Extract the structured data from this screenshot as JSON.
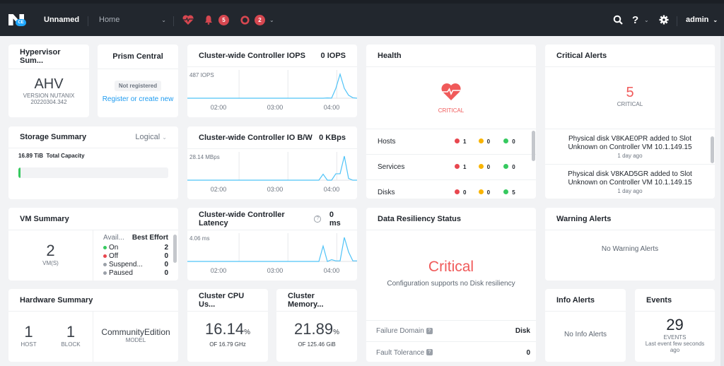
{
  "topbar": {
    "cluster_name": "Unnamed",
    "logo_badge": "CE",
    "nav_current": "Home",
    "alerts_count": "5",
    "tasks_count": "2",
    "user": "admin",
    "icons": [
      "health-heart-icon",
      "bell-icon",
      "circle-task-icon",
      "search-icon",
      "help-icon",
      "gear-icon"
    ]
  },
  "hypervisor": {
    "title": "Hypervisor Sum...",
    "name": "AHV",
    "version_label": "VERSION NUTANIX",
    "version": "20220304.342"
  },
  "prism_central": {
    "title": "Prism Central",
    "status": "Not registered",
    "link": "Register or create new"
  },
  "storage": {
    "title": "Storage Summary",
    "view": "Logical",
    "capacity_value": "16.89 TiB",
    "capacity_label": "Total Capacity",
    "used_fraction": 0.005,
    "bar_color": "#36c95f"
  },
  "vm_summary": {
    "title": "VM Summary",
    "count": "2",
    "count_label": "VM(S)",
    "col1": "Avail...",
    "col2": "Best Effort",
    "rows": [
      {
        "label": "On",
        "value": "2",
        "color": "#36c95f"
      },
      {
        "label": "Off",
        "value": "0",
        "color": "#e8474f"
      },
      {
        "label": "Suspend...",
        "value": "0",
        "color": "#9aa0a8"
      },
      {
        "label": "Paused",
        "value": "0",
        "color": "#9aa0a8"
      }
    ]
  },
  "hardware": {
    "title": "Hardware Summary",
    "hosts": "1",
    "hosts_label": "HOST",
    "blocks": "1",
    "blocks_label": "BLOCK",
    "model": "CommunityEdition",
    "model_label": "MODEL"
  },
  "iops": {
    "title": "Cluster-wide Controller IOPS",
    "current": "0 IOPS",
    "max_label": "487 IOPS"
  },
  "iobw": {
    "title": "Cluster-wide Controller IO B/W",
    "current": "0 KBps",
    "max_label": "28.14 MBps"
  },
  "latency": {
    "title": "Cluster-wide Controller Latency",
    "current": "0 ms",
    "max_label": "4.06 ms"
  },
  "cpu": {
    "title": "Cluster CPU Us...",
    "value": "16.14",
    "unit": "%",
    "of": "OF 16.79 GHz"
  },
  "memory": {
    "title": "Cluster Memory...",
    "value": "21.89",
    "unit": "%",
    "of": "OF 125.46 GiB"
  },
  "health": {
    "title": "Health",
    "status": "CRITICAL",
    "rows": [
      {
        "label": "Hosts",
        "critical": "1",
        "warning": "0",
        "good": "0"
      },
      {
        "label": "Services",
        "critical": "1",
        "warning": "0",
        "good": "0"
      },
      {
        "label": "Disks",
        "critical": "0",
        "warning": "0",
        "good": "5"
      }
    ],
    "colors": {
      "critical": "#e8474f",
      "warning": "#f9b400",
      "good": "#36c95f"
    }
  },
  "resiliency": {
    "title": "Data Resiliency Status",
    "status": "Critical",
    "message": "Configuration supports no Disk resiliency",
    "failure_domain_label": "Failure Domain",
    "failure_domain": "Disk",
    "fault_tolerance_label": "Fault Tolerance",
    "fault_tolerance": "0"
  },
  "critical_alerts": {
    "title": "Critical Alerts",
    "count": "5",
    "label": "CRITICAL",
    "items": [
      {
        "text": "Physical disk V8KAE0PR added to Slot Unknown on Controller VM 10.1.149.15",
        "time": "1 day ago"
      },
      {
        "text": "Physical disk V8KAD5GR added to Slot Unknown on Controller VM 10.1.149.15",
        "time": "1 day ago"
      }
    ]
  },
  "warning_alerts": {
    "title": "Warning Alerts",
    "empty": "No Warning Alerts"
  },
  "info_alerts": {
    "title": "Info Alerts",
    "empty": "No Info Alerts"
  },
  "events": {
    "title": "Events",
    "count": "29",
    "label": "EVENTS",
    "last": "Last event few seconds ago"
  },
  "chart_data": [
    {
      "type": "line",
      "title": "Cluster-wide Controller IOPS",
      "ylabel": "IOPS",
      "ylim": [
        0,
        487
      ],
      "x_ticks": [
        "02:00",
        "03:00",
        "04:00"
      ],
      "x": [
        0,
        10,
        20,
        30,
        40,
        50,
        60,
        62,
        64,
        66,
        68,
        70,
        72,
        74,
        76,
        78,
        80
      ],
      "values": [
        0,
        0,
        0,
        0,
        0,
        0,
        0,
        0,
        0,
        5,
        2,
        200,
        487,
        200,
        60,
        10,
        0
      ],
      "grid": true,
      "color": "#4fc3f7"
    },
    {
      "type": "line",
      "title": "Cluster-wide Controller IO B/W",
      "ylabel": "MBps",
      "ylim": [
        0,
        28.14
      ],
      "x_ticks": [
        "02:00",
        "03:00",
        "04:00"
      ],
      "x": [
        0,
        10,
        20,
        30,
        40,
        50,
        60,
        62,
        64,
        66,
        68,
        70,
        72,
        74,
        76,
        78,
        80
      ],
      "values": [
        0,
        0,
        0,
        0,
        0,
        0,
        0,
        0,
        7,
        0,
        0,
        7.5,
        7.5,
        28.14,
        2,
        0,
        0
      ],
      "grid": true,
      "color": "#4fc3f7"
    },
    {
      "type": "line",
      "title": "Cluster-wide Controller Latency",
      "ylabel": "ms",
      "ylim": [
        0,
        4.06
      ],
      "x_ticks": [
        "02:00",
        "03:00",
        "04:00"
      ],
      "x": [
        0,
        10,
        20,
        30,
        40,
        50,
        60,
        62,
        64,
        66,
        68,
        70,
        72,
        74,
        76,
        78,
        80
      ],
      "values": [
        0,
        0,
        0,
        0,
        0,
        0,
        0,
        0,
        2.6,
        0,
        0.3,
        0.1,
        0.1,
        4.06,
        1.6,
        0.1,
        0.1
      ],
      "grid": true,
      "color": "#4fc3f7"
    }
  ]
}
